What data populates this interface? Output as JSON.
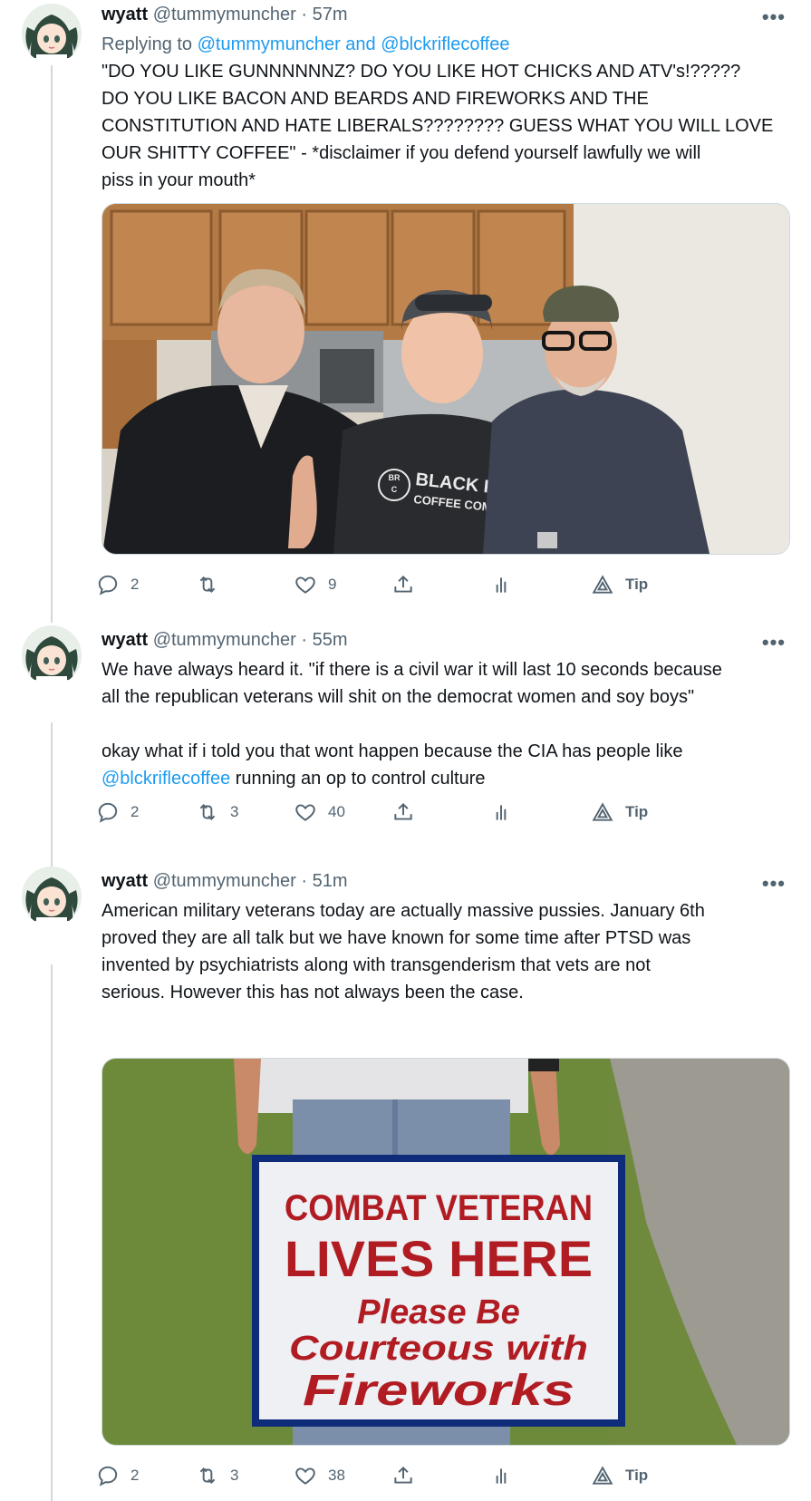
{
  "tweets": [
    {
      "name": "wyatt",
      "handle": "@tummymuncher",
      "time": "57m",
      "more": "•••",
      "reply_prefix": "Replying to ",
      "reply_handles": "@tummymuncher and @blckriflecoffee",
      "text": "\"DO YOU LIKE GUNNNNNNZ? DO YOU LIKE HOT CHICKS AND ATV's!?????\nDO YOU LIKE BACON AND BEARDS AND FIREWORKS AND THE\nCONSTITUTION AND HATE LIBERALS???????? GUESS WHAT YOU WILL LOVE\nOUR SHITTY COFFEE\" - *disclaimer if you defend yourself lawfully we will\npiss in your mouth*",
      "media": {
        "shirt_logo": "BR\nC",
        "shirt_text_1": "BLACK RIFLE",
        "shirt_text_2": "COFFEE COMPANY"
      },
      "actions": {
        "replies": "2",
        "retweets": "",
        "likes": "9",
        "tip": "Tip"
      }
    },
    {
      "name": "wyatt",
      "handle": "@tummymuncher",
      "time": "55m",
      "more": "•••",
      "text_1": "We have always heard it. \"if there is a civil war it will last 10 seconds because\nall the republican veterans will shit on the democrat women and soy boys\"\n\nokay what if i told you that wont happen because the CIA has people like\n",
      "text_link": "@blckriflecoffee",
      "text_2": " running an op to control culture",
      "actions": {
        "replies": "2",
        "retweets": "3",
        "likes": "40",
        "tip": "Tip"
      }
    },
    {
      "name": "wyatt",
      "handle": "@tummymuncher",
      "time": "51m",
      "more": "•••",
      "text": "American military veterans today are actually massive pussies. January 6th\nproved they are all talk but we have known for some time after PTSD was\ninvented by psychiatrists along with transgenderism that vets are not\nserious. However this has not always been the case.",
      "media": {
        "sign_line_1": "COMBAT VETERAN",
        "sign_line_2": "LIVES HERE",
        "sign_line_3": "Please Be",
        "sign_line_4": "Courteous with",
        "sign_line_5": "Fireworks"
      },
      "actions": {
        "replies": "2",
        "retweets": "3",
        "likes": "38",
        "tip": "Tip"
      }
    }
  ],
  "colors": {
    "text": "#0f1419",
    "secondary": "#536471",
    "link": "#1d9bf0",
    "thread_line": "#cfd9de",
    "sign_red": "#b01c22",
    "sign_blue": "#1f3d8a"
  },
  "icons": [
    "reply-icon",
    "retweet-icon",
    "like-icon",
    "share-icon",
    "analytics-icon",
    "tip-icon",
    "more-icon"
  ]
}
